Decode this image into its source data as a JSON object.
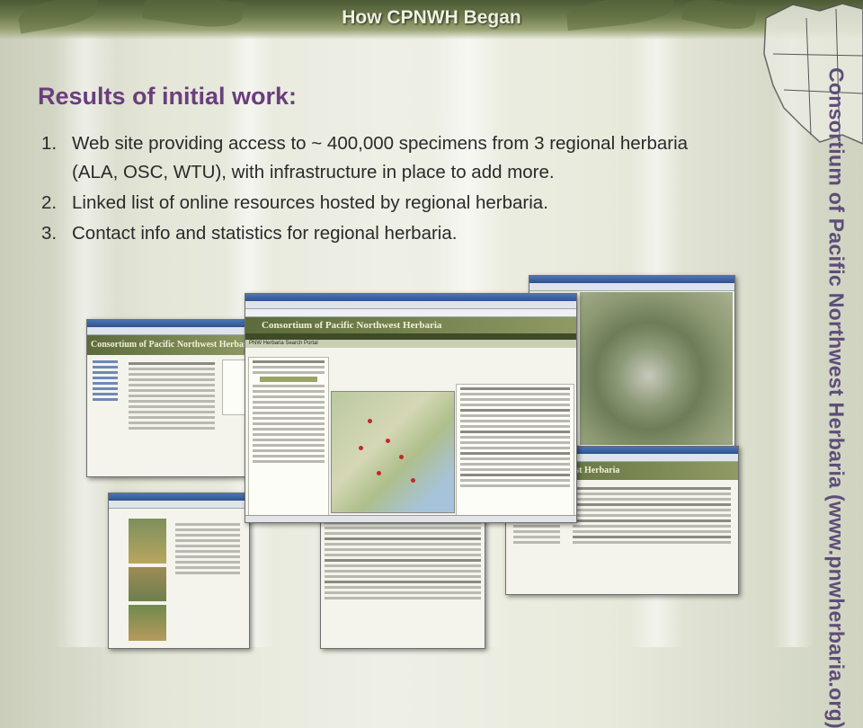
{
  "header": {
    "title": "How CPNWH Began"
  },
  "sidebar": {
    "text": "Consortium of Pacific Northwest Herbaria (www.pnwherbaria.org)"
  },
  "content": {
    "heading": "Results of initial work:",
    "items": [
      {
        "num": "1.",
        "text": "Web site providing access to ~ 400,000 specimens from 3 regional herbaria (ALA, OSC, WTU), with infrastructure in place to add more."
      },
      {
        "num": "2.",
        "text": "Linked list of online resources hosted by regional herbaria."
      },
      {
        "num": "3.",
        "text": "Contact info and statistics for regional herbaria."
      }
    ]
  },
  "screenshots": {
    "left_banner": "Consortium of Pacific Northwest Herbaria",
    "center_banner": "Consortium of Pacific Northwest Herbaria",
    "center_subbar": "PNW Herbaria Search Portal",
    "right_banner": "hwest Herbaria"
  },
  "colors": {
    "accent_purple": "#6a3e7c",
    "banner_green": "#5b6b3a",
    "sidebar_text": "#5e4d7a"
  }
}
